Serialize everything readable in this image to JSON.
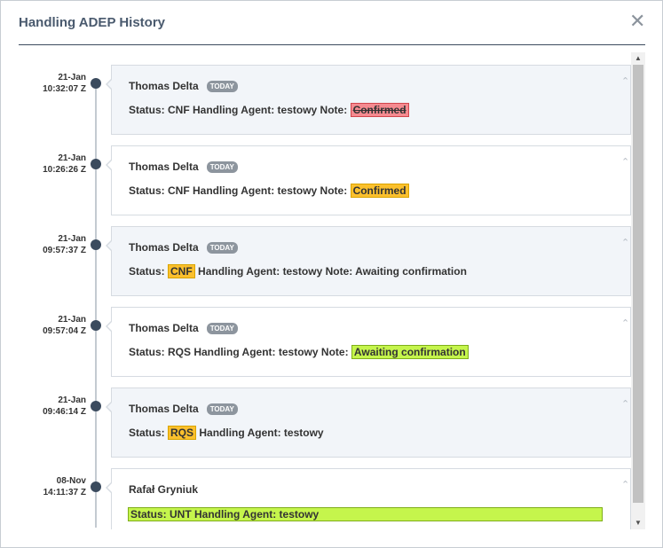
{
  "dialog": {
    "title": "Handling ADEP History",
    "close_icon": "close-icon"
  },
  "entries": [
    {
      "date": "21-Jan",
      "time": "10:32:07 Z",
      "author": "Thomas Delta",
      "badge": "TODAY",
      "status_prefix": "Status: CNF Handling Agent: testowy Note: ",
      "highlight": "Confirmed",
      "highlight_style": "red-strike",
      "suffix": ""
    },
    {
      "date": "21-Jan",
      "time": "10:26:26 Z",
      "author": "Thomas Delta",
      "badge": "TODAY",
      "status_prefix": "Status: CNF Handling Agent: testowy Note: ",
      "highlight": "Confirmed",
      "highlight_style": "yellow",
      "suffix": ""
    },
    {
      "date": "21-Jan",
      "time": "09:57:37 Z",
      "author": "Thomas Delta",
      "badge": "TODAY",
      "status_prefix": "Status: ",
      "highlight": "CNF",
      "highlight_style": "yellow",
      "suffix": " Handling Agent: testowy Note: Awaiting confirmation"
    },
    {
      "date": "21-Jan",
      "time": "09:57:04 Z",
      "author": "Thomas Delta",
      "badge": "TODAY",
      "status_prefix": "Status: RQS Handling Agent: testowy Note: ",
      "highlight": "Awaiting confirmation",
      "highlight_style": "green",
      "suffix": ""
    },
    {
      "date": "21-Jan",
      "time": "09:46:14 Z",
      "author": "Thomas Delta",
      "badge": "TODAY",
      "status_prefix": "Status: ",
      "highlight": "RQS",
      "highlight_style": "yellow",
      "suffix": " Handling Agent: testowy"
    },
    {
      "date": "08-Nov",
      "time": "14:11:37 Z",
      "author": "Rafał Gryniuk",
      "badge": "",
      "status_prefix": "",
      "highlight": "Status: UNT Handling Agent: testowy",
      "highlight_style": "green-wide",
      "suffix": ""
    }
  ],
  "icons": {
    "collapse": "chevron-up-icon",
    "scroll_up": "scroll-up-arrow",
    "scroll_down": "scroll-down-arrow"
  },
  "colors": {
    "title": "#4a5a6e",
    "timeline_dot": "#3b4b5e",
    "highlight_yellow": "#fbc02d",
    "highlight_red": "#f58a90",
    "highlight_green": "#c5f54c",
    "card_shaded": "#f2f5f9"
  }
}
